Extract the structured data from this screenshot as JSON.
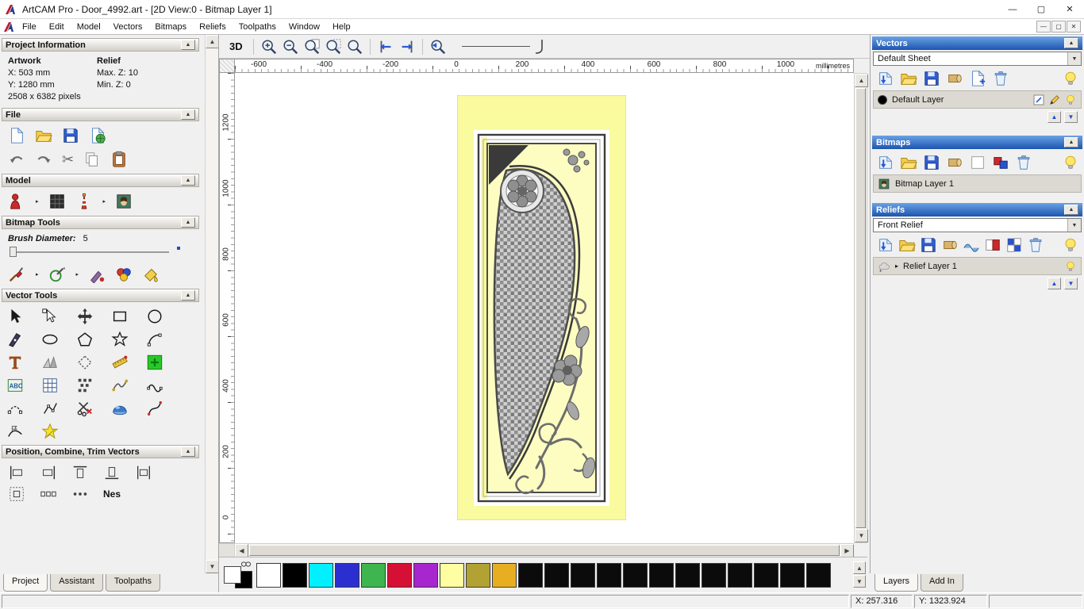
{
  "window": {
    "title": "ArtCAM Pro - Door_4992.art - [2D View:0 - Bitmap Layer 1]",
    "menu": [
      "File",
      "Edit",
      "Model",
      "Vectors",
      "Bitmaps",
      "Reliefs",
      "Toolpaths",
      "Window",
      "Help"
    ],
    "controls": {
      "minimize": "—",
      "maximize": "▢",
      "close": "✕"
    }
  },
  "icons": {
    "collapse_arrow": "▲",
    "dropdown_arrow": "▼",
    "scroll_up": "▲",
    "scroll_down": "▼",
    "scroll_left": "◀",
    "scroll_right": "▶",
    "layer_up": "▲",
    "layer_down": "▼",
    "expand_arrow": "▸",
    "scissors": "✂"
  },
  "left_panel": {
    "project_information": {
      "title": "Project Information",
      "artwork": {
        "label": "Artwork",
        "x": "X: 503 mm",
        "y": "Y: 1280 mm",
        "pixels": "2508 x 6382 pixels"
      },
      "relief": {
        "label": "Relief",
        "max_z": "Max. Z: 10",
        "min_z": "Min. Z: 0"
      }
    },
    "file_section_title": "File",
    "model_section_title": "Model",
    "bitmap_tools": {
      "title": "Bitmap Tools",
      "brush_label": "Brush Diameter:",
      "brush_value": "5"
    },
    "vector_tools_title": "Vector Tools",
    "position_section_title": "Position, Combine, Trim Vectors",
    "nesting_partial_label": "Nes",
    "tabs": [
      "Project",
      "Assistant",
      "Toolpaths"
    ],
    "active_tab": "Project"
  },
  "canvas": {
    "toolbar": {
      "view_3d_label": "3D"
    },
    "h_ruler": {
      "labels": [
        "-600",
        "-400",
        "-200",
        "0",
        "200",
        "400",
        "600",
        "800",
        "1000"
      ],
      "unit": "millimetres"
    },
    "v_ruler": {
      "labels": [
        "1200",
        "1000",
        "800",
        "600",
        "400",
        "200",
        "0"
      ]
    }
  },
  "palette": {
    "colors": [
      "#ffffff",
      "#000000",
      "#00f0ff",
      "#2b2fd0",
      "#3eb54e",
      "#d60f35",
      "#a726cd",
      "#ffffa2",
      "#b2a233",
      "#e7ae22",
      "#0b0b0b",
      "#0b0b0b",
      "#0b0b0b",
      "#0b0b0b",
      "#0b0b0b",
      "#0b0b0b",
      "#0b0b0b",
      "#0b0b0b",
      "#0b0b0b",
      "#0b0b0b",
      "#0b0b0b",
      "#0b0b0b"
    ]
  },
  "right_panel": {
    "vectors": {
      "title": "Vectors",
      "sheet_selector": "Default Sheet",
      "layer_name": "Default Layer"
    },
    "bitmaps": {
      "title": "Bitmaps",
      "layer_name": "Bitmap Layer 1"
    },
    "reliefs": {
      "title": "Reliefs",
      "relief_selector": "Front Relief",
      "layer_name": "Relief Layer 1"
    },
    "tabs": [
      "Layers",
      "Add In"
    ],
    "active_tab": "Layers"
  },
  "status_bar": {
    "x": "X: 257.316",
    "y": "Y: 1323.924"
  }
}
